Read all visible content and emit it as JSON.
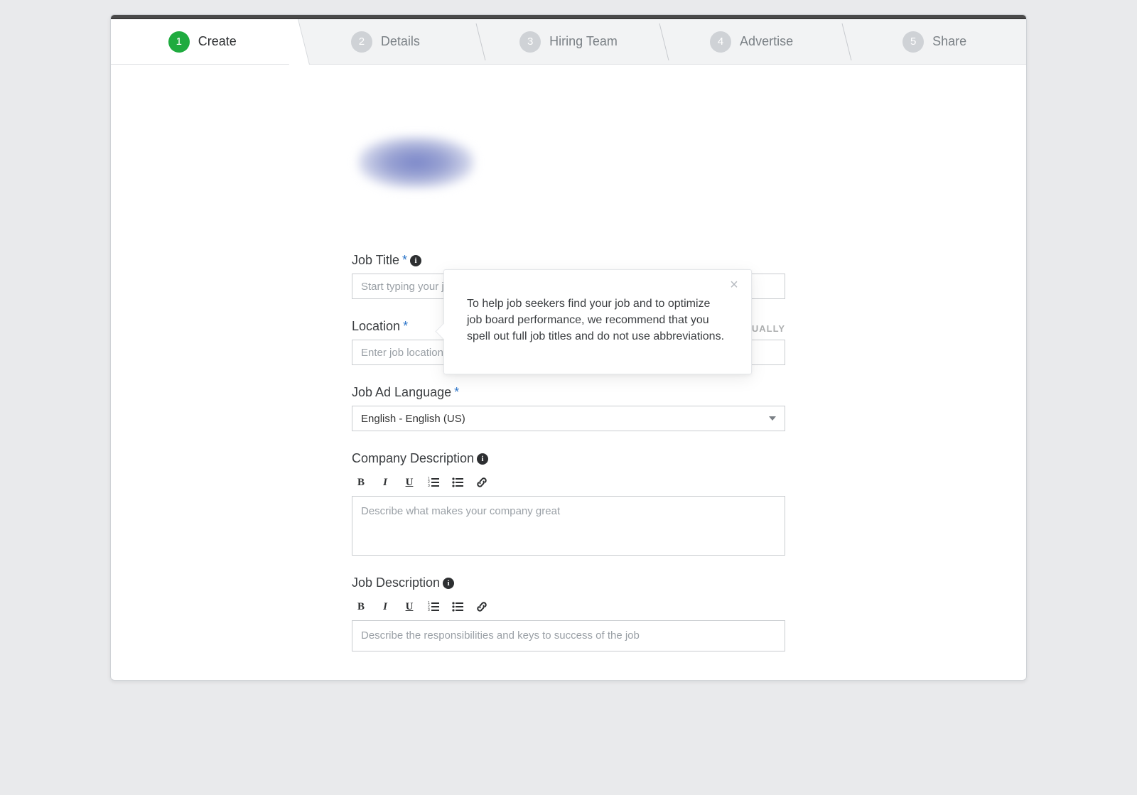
{
  "steps": [
    {
      "num": "1",
      "label": "Create",
      "active": true
    },
    {
      "num": "2",
      "label": "Details",
      "active": false
    },
    {
      "num": "3",
      "label": "Hiring Team",
      "active": false
    },
    {
      "num": "4",
      "label": "Advertise",
      "active": false
    },
    {
      "num": "5",
      "label": "Share",
      "active": false
    }
  ],
  "tooltip": {
    "text": "To help job seekers find your job and to optimize job board performance, we recommend that you spell out full job titles and do not use abbreviations."
  },
  "fields": {
    "job_title": {
      "label": "Job Title",
      "required_mark": "*",
      "placeholder": "Start typing your job title"
    },
    "location": {
      "label": "Location",
      "required_mark": "*",
      "placeholder": "Enter job location",
      "right_action": "ENTER LOCATION MANUALLY"
    },
    "language": {
      "label": "Job Ad Language",
      "required_mark": "*",
      "value": "English - English (US)"
    },
    "company_desc": {
      "label": "Company Description",
      "placeholder": "Describe what makes your company great"
    },
    "job_desc": {
      "label": "Job Description",
      "placeholder": "Describe the responsibilities and keys to success of the job"
    }
  },
  "editor_tools": {
    "bold": "B",
    "italic": "I",
    "underline": "U"
  }
}
